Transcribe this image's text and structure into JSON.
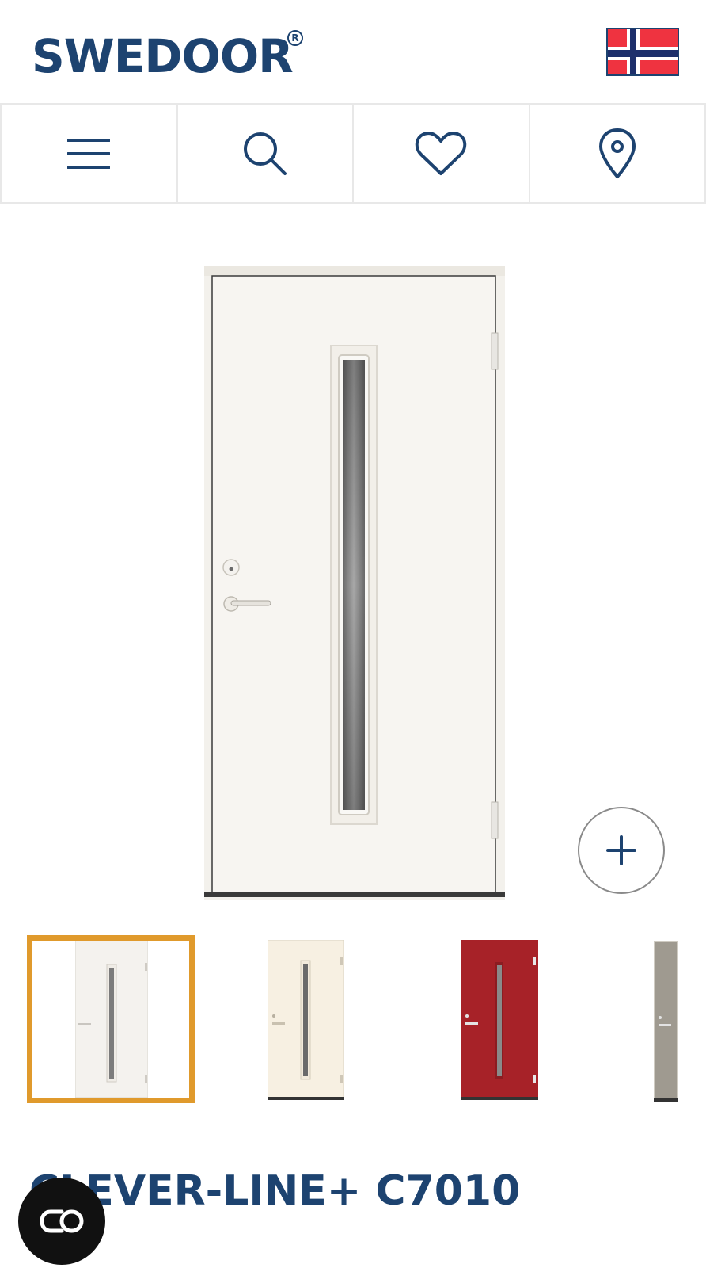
{
  "brand": {
    "logo_text": "SWEDOOR",
    "registered_mark": "R"
  },
  "header": {
    "country_flag": "norway-flag-icon"
  },
  "nav": {
    "items": [
      {
        "icon": "menu-icon"
      },
      {
        "icon": "search-icon"
      },
      {
        "icon": "heart-icon"
      },
      {
        "icon": "location-pin-icon"
      }
    ]
  },
  "product": {
    "title": "CLEVER-LINE+ C7010",
    "zoom_icon": "plus-icon"
  },
  "thumbnails": [
    {
      "color_name": "white",
      "door_color": "#f4f2ee",
      "selected": true
    },
    {
      "color_name": "cream",
      "door_color": "#f7f0e2",
      "selected": false
    },
    {
      "color_name": "red",
      "door_color": "#a72228",
      "selected": false
    },
    {
      "color_name": "grey",
      "door_color": "#9f9a90",
      "selected": false
    }
  ],
  "colors": {
    "brand_blue": "#1d4370",
    "selected_border": "#e09a2c",
    "divider": "#e8e8e8"
  },
  "chat": {
    "icon": "chat-icon"
  }
}
